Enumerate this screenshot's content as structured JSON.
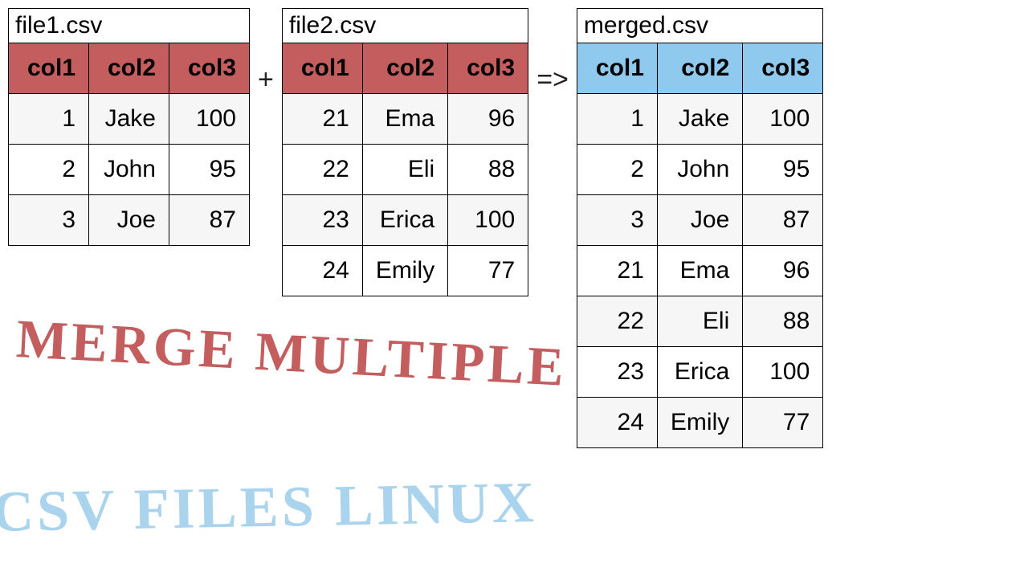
{
  "operators": {
    "plus": "+",
    "arrow": "=>"
  },
  "tables": [
    {
      "filename": "file1.csv",
      "headerClass": "red-header",
      "columns": [
        "col1",
        "col2",
        "col3"
      ],
      "rows": [
        [
          "1",
          "Jake",
          "100"
        ],
        [
          "2",
          "John",
          "95"
        ],
        [
          "3",
          "Joe",
          "87"
        ]
      ]
    },
    {
      "filename": "file2.csv",
      "headerClass": "red-header",
      "columns": [
        "col1",
        "col2",
        "col3"
      ],
      "rows": [
        [
          "21",
          "Ema",
          "96"
        ],
        [
          "22",
          "Eli",
          "88"
        ],
        [
          "23",
          "Erica",
          "100"
        ],
        [
          "24",
          "Emily",
          "77"
        ]
      ]
    },
    {
      "filename": "merged.csv",
      "headerClass": "blue-header",
      "columns": [
        "col1",
        "col2",
        "col3"
      ],
      "rows": [
        [
          "1",
          "Jake",
          "100"
        ],
        [
          "2",
          "John",
          "95"
        ],
        [
          "3",
          "Joe",
          "87"
        ],
        [
          "21",
          "Ema",
          "96"
        ],
        [
          "22",
          "Eli",
          "88"
        ],
        [
          "23",
          "Erica",
          "100"
        ],
        [
          "24",
          "Emily",
          "77"
        ]
      ]
    }
  ],
  "handwriting": {
    "line1": "MERGE MULTIPLE",
    "line2": "CSV FILES LINUX"
  }
}
